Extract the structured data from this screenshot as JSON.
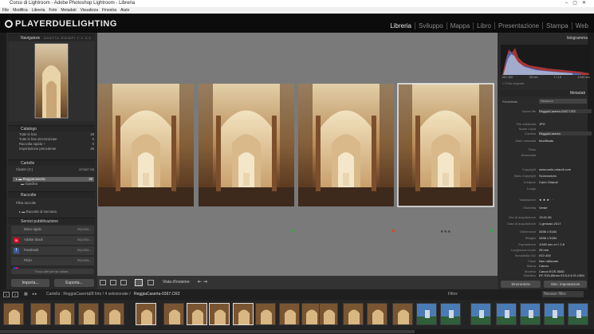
{
  "window": {
    "title": "Corso di Lightroom - Adobe Photoshop Lightroom - Libreria"
  },
  "menu": [
    "File",
    "Modifica",
    "Libreria",
    "Foto",
    "Metadati",
    "Visualizza",
    "Finestra",
    "Aiuto"
  ],
  "brand": "PLAYERDUELIGHTING",
  "modules": [
    "Libreria",
    "Sviluppo",
    "Mappa",
    "Libro",
    "Presentazione",
    "Stampa",
    "Web"
  ],
  "left": {
    "navigator": {
      "title": "Navigatore",
      "zooms": [
        "ADATTA",
        "RIEMPI",
        "1:1",
        "4:1"
      ]
    },
    "catalog": {
      "title": "Catalogo",
      "items": [
        {
          "label": "Tutte le foto",
          "count": "28"
        },
        {
          "label": "Tutte le foto sincronizzate",
          "count": "0"
        },
        {
          "label": "Raccolta rapida +",
          "count": "0"
        },
        {
          "label": "Importazione precedente",
          "count": "28"
        }
      ]
    },
    "folders": {
      "title": "Cartelle",
      "volume": "Cluster (X:)",
      "volume_info": "227/627 GB",
      "items": [
        {
          "label": "ReggiaCaserta",
          "count": "28"
        },
        {
          "label": "Giardino",
          "count": ""
        }
      ]
    },
    "collections": {
      "title": "Raccolte",
      "items": [
        "Filtra raccolte",
        "Raccolte di memoria"
      ]
    },
    "publish": {
      "title": "Servizi pubblicazione",
      "items": [
        {
          "label": "Disco rigido",
          "action": "Imposta..."
        },
        {
          "label": "Adobe Stock",
          "action": "Imposta..."
        },
        {
          "label": "Facebook",
          "action": "Imposta..."
        },
        {
          "label": "Flickr",
          "action": "Imposta..."
        }
      ],
      "find_more": "Trova altri servizi online..."
    },
    "import_label": "Importa...",
    "export_label": "Esporta..."
  },
  "toolbar": {
    "sort_label": "Vista d'insieme:"
  },
  "filmstrip_header": {
    "path": "Cartella : ReggiaCaserta",
    "info": "28 foto / 4 selezionate /",
    "file": "ReggiaCaserta-0367.CR2",
    "filter_label": "Filtro:",
    "filter_value": "Nessun filtro"
  },
  "right": {
    "histogram_title": "Istogramma",
    "histogram_readout": [
      "ISO 400",
      "28 mm",
      "f / 2,8",
      "1/160 sec"
    ],
    "original_photo": "Foto originale",
    "preset_label": "Predefinito",
    "preset_value": "Nessuno",
    "metadata_title": "Metadati",
    "fields": [
      {
        "label": "Nome file",
        "value": "ReggiaCaserta-0367.CR2"
      },
      {
        "label": "File collaterali",
        "value": "JPG"
      },
      {
        "label": "Nome copia",
        "value": ""
      },
      {
        "label": "Cartella",
        "value": "ReggiaCaserta"
      },
      {
        "label": "Stato metadati",
        "value": "Modificato"
      },
      {
        "label": "Titolo",
        "value": ""
      },
      {
        "label": "Didascalia",
        "value": ""
      },
      {
        "label": "Copyright",
        "value": "www.carlo-orlandi.com"
      },
      {
        "label": "Stato Copyright",
        "value": "Sconosciuto"
      },
      {
        "label": "Creatore",
        "value": "Carlo Orlandi"
      },
      {
        "label": "Luogo",
        "value": ""
      },
      {
        "label": "Valutazione",
        "value": "★ ★ ★ · ·"
      },
      {
        "label": "Etichetta",
        "value": "Verde"
      },
      {
        "label": "Ora di acquisizione",
        "value": "13:41:36"
      },
      {
        "label": "Data di acquisizione",
        "value": "1 gennaio 2017"
      },
      {
        "label": "Dimensioni",
        "value": "3456 x 5184"
      },
      {
        "label": "Ritaglio",
        "value": "3456 x 5184"
      },
      {
        "label": "Esposizione",
        "value": "1/160 sec a f / 2,8"
      },
      {
        "label": "Lunghezza focale",
        "value": "28 mm"
      },
      {
        "label": "Sensibilità ISO",
        "value": "ISO 400"
      },
      {
        "label": "Flash",
        "value": "Non utilizzato"
      },
      {
        "label": "Marca",
        "value": "Canon"
      },
      {
        "label": "Modello",
        "value": "Canon EOS 550D"
      },
      {
        "label": "Obiettivo",
        "value": "EF-S15-85mm f/3.5-5.6 IS USM"
      }
    ],
    "sync_label": "Sincronizza",
    "sync_settings_label": "Sinc. impostazioni"
  }
}
